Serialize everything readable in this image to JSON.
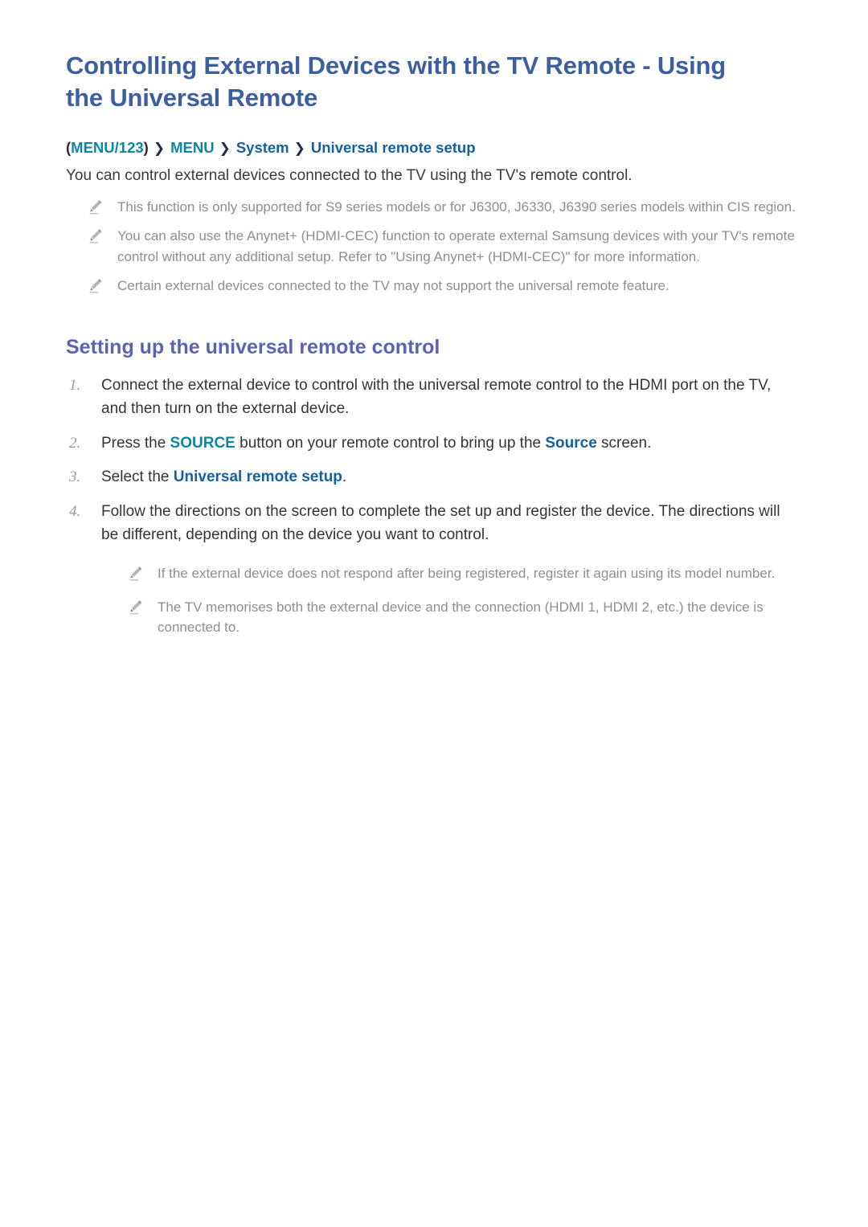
{
  "page": {
    "title": "Controlling External Devices with the TV Remote - Using the Universal Remote"
  },
  "breadcrumb": {
    "open_paren": "(",
    "close_paren": ")",
    "item1": "MENU/123",
    "separator": "❯",
    "item2": "MENU",
    "item3": "System",
    "item4": "Universal remote setup"
  },
  "intro": {
    "paragraph": "You can control external devices connected to the TV using the TV's remote control.",
    "notes": [
      "This function is only supported for S9 series models or for J6300, J6330, J6390 series models within CIS region.",
      "You can also use the Anynet+ (HDMI-CEC) function to operate external Samsung devices with your TV's remote control without any additional setup. Refer to \"Using Anynet+ (HDMI-CEC)\" for more information.",
      "Certain external devices connected to the TV may not support the universal remote feature."
    ]
  },
  "section": {
    "heading": "Setting up the universal remote control",
    "steps": [
      {
        "number": "1.",
        "text_before": "Connect the external device to control with the universal remote control to the HDMI port on the TV, and then turn on the external device.",
        "keyword_teal": "",
        "text_middle": "",
        "keyword_blue": "",
        "text_after": ""
      },
      {
        "number": "2.",
        "text_before": "Press the ",
        "keyword_teal": "SOURCE",
        "text_middle": " button on your remote control to bring up the ",
        "keyword_blue": "Source",
        "text_after": " screen."
      },
      {
        "number": "3.",
        "text_before": "Select the ",
        "keyword_teal": "",
        "text_middle": "",
        "keyword_blue": "Universal remote setup",
        "text_after": "."
      },
      {
        "number": "4.",
        "text_before": "Follow the directions on the screen to complete the set up and register the device. The directions will be different, depending on the device you want to control.",
        "keyword_teal": "",
        "text_middle": "",
        "keyword_blue": "",
        "text_after": ""
      }
    ],
    "step4_notes": [
      "If the external device does not respond after being registered, register it again using its model number.",
      "The TV memorises both the external device and the connection (HDMI 1, HDMI 2, etc.) the device is connected to."
    ]
  },
  "colors": {
    "title_blue": "#3d5fa0",
    "heading_purple": "#5a63b5",
    "accent_teal": "#0b87a0",
    "accent_blue": "#15609f",
    "note_gray": "#8a8f91",
    "body_text": "#3a3a3a"
  }
}
